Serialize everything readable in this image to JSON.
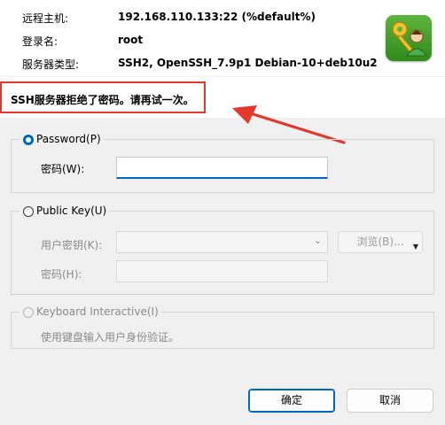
{
  "header": {
    "remote_host_label": "远程主机:",
    "remote_host_value": "192.168.110.133:22 (%default%)",
    "login_name_label": "登录名:",
    "login_name_value": "root",
    "server_type_label": "服务器类型:",
    "server_type_value": "SSH2, OpenSSH_7.9p1 Debian-10+deb10u2"
  },
  "message": "SSH服务器拒绝了密码。请再试一次。",
  "password_group": {
    "label": "Password(P)",
    "field_label": "密码(W):",
    "field_value": ""
  },
  "public_key_group": {
    "label": "Public Key(U)",
    "user_key_label": "用户密钥(K):",
    "browse_label": "浏览(B)...",
    "passphrase_label": "密码(H):"
  },
  "keyboard_group": {
    "label": "Keyboard Interactive(I)",
    "description": "使用键盘输入用户身份验证。"
  },
  "buttons": {
    "ok": "确定",
    "cancel": "取消"
  },
  "colors": {
    "accent": "#0067c0",
    "annotation": "#e5382d"
  }
}
